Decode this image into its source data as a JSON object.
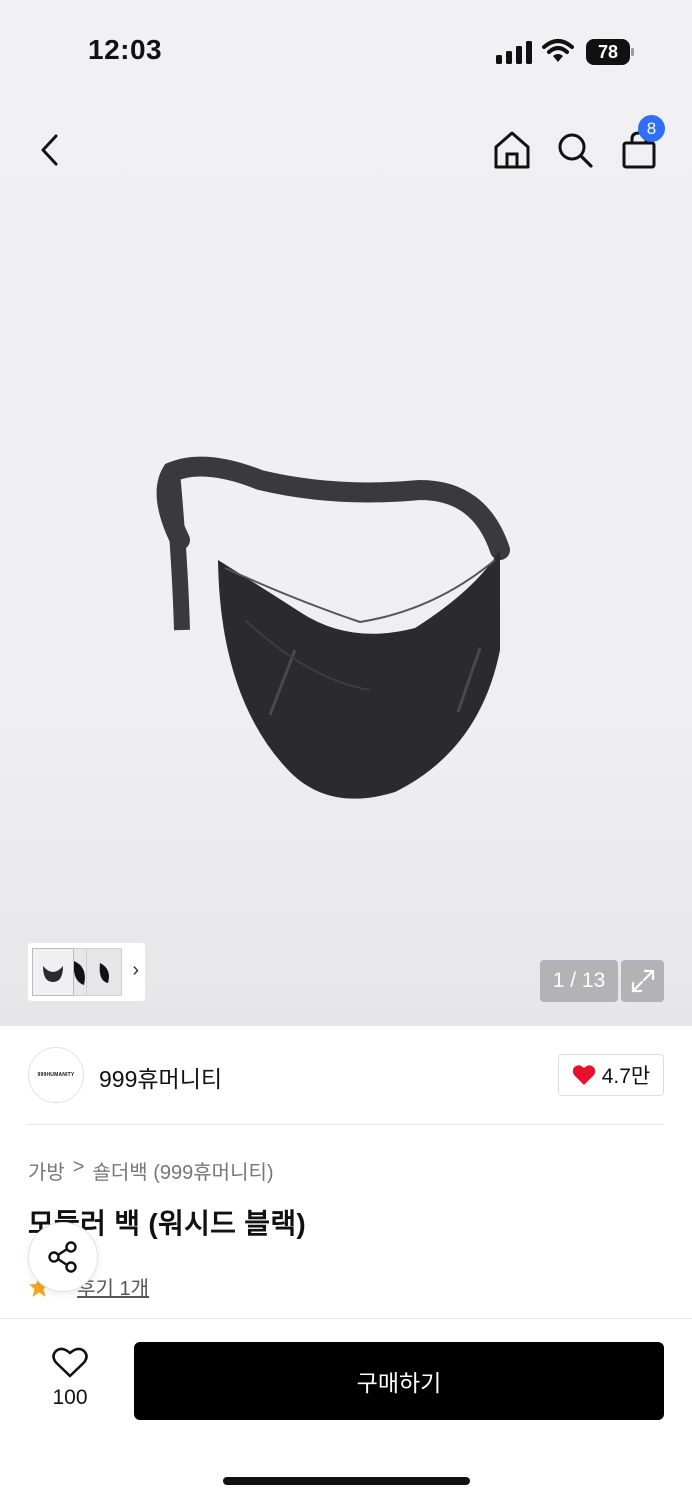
{
  "status_bar": {
    "time": "12:03",
    "battery": "78"
  },
  "nav": {
    "cart_count": "8"
  },
  "gallery": {
    "pager": "1 / 13"
  },
  "brand": {
    "logo_text": "999HUMANITY",
    "name": "999휴머니티",
    "likes": "4.7만"
  },
  "breadcrumb": {
    "category": "가방",
    "separator": ">",
    "subcategory": "숄더백 (999휴머니티)"
  },
  "product": {
    "title": "모듈러 백 (워시드 블랙)",
    "rating": "5",
    "reviews": "후기 1개"
  },
  "bottom": {
    "wish_count": "100",
    "buy_label": "구매하기"
  },
  "colors": {
    "accent": "#2f6ef5",
    "heart": "#e8102a",
    "star": "#f5a623",
    "buy_bg": "#000000"
  },
  "icons": [
    "back-icon",
    "home-icon",
    "search-icon",
    "cart-icon",
    "expand-icon",
    "heart-icon",
    "share-icon",
    "star-icon",
    "chevron-right-icon"
  ]
}
